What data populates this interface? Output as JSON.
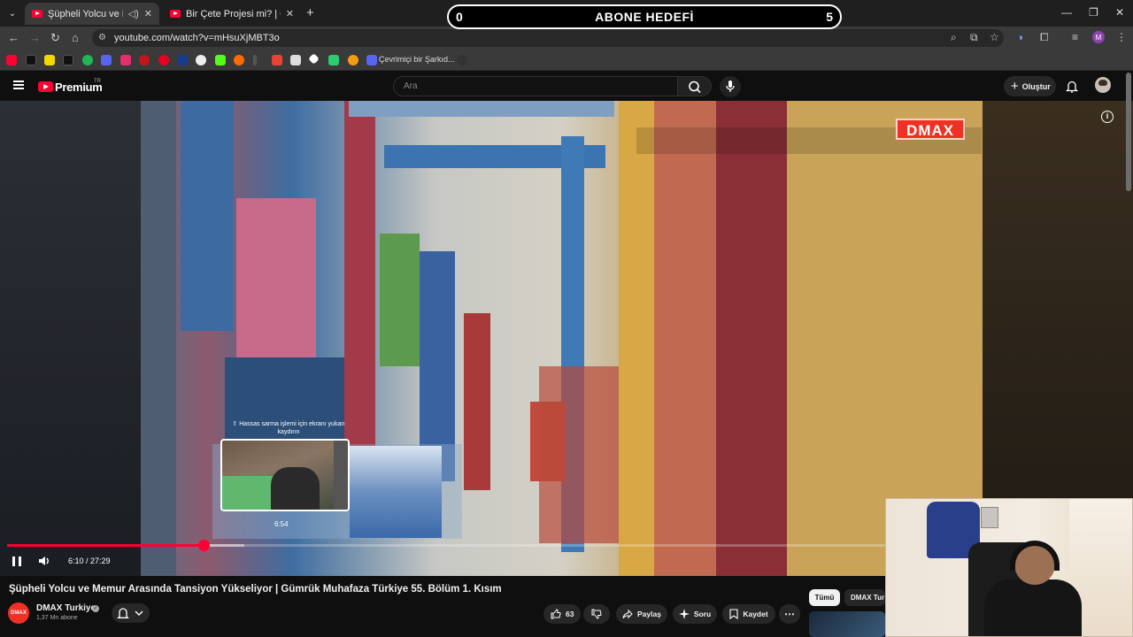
{
  "browser": {
    "tabs": [
      {
        "title": "Şüpheli Yolcu ve Memur Arasında Tansiyon Yükseliyor",
        "active": true,
        "audio": true
      },
      {
        "title": "Bir Çete Projesi mi? | Central Cee",
        "active": false,
        "audio": false
      }
    ],
    "url": "youtube.com/watch?v=mHsuXjMBT3o",
    "bookmarks": {
      "label": "Çevrimiçi bir Şarkıd..."
    }
  },
  "overlay_goal": {
    "left_value": "0",
    "title": "ABONE HEDEFİ",
    "right_value": "5"
  },
  "youtube": {
    "logo": "Premium",
    "logo_badge": "TR",
    "search_placeholder": "Ara",
    "create_label": "Oluştur"
  },
  "player": {
    "channel_watermark": "DMAX",
    "seek_hint": "Hassas sarma işlemi için ekranı yukarı kaydırın",
    "preview_time": "6:54",
    "current_time": "6:10",
    "duration": "27:29",
    "time_display": "6:10 / 27:29",
    "progress_fraction": 0.224,
    "buffered_fraction": 0.27
  },
  "video": {
    "title": "Şüpheli Yolcu ve Memur Arasında Tansiyon Yükseliyor | Gümrük Muhafaza Türkiye 55. Bölüm 1. Kısım",
    "channel": {
      "avatar_text": "DMAX",
      "name": "DMAX Turkiye",
      "subscribers": "1,37 Mn abone"
    },
    "actions": {
      "likes": "63",
      "share": "Paylaş",
      "ask": "Soru",
      "save": "Kaydet"
    }
  },
  "recommendations": {
    "chips": [
      "Tümü",
      "DMAX Tur"
    ]
  },
  "colors": {
    "accent": "#ff0033",
    "dmax": "#ee3124",
    "background": "#0f0f0f"
  }
}
